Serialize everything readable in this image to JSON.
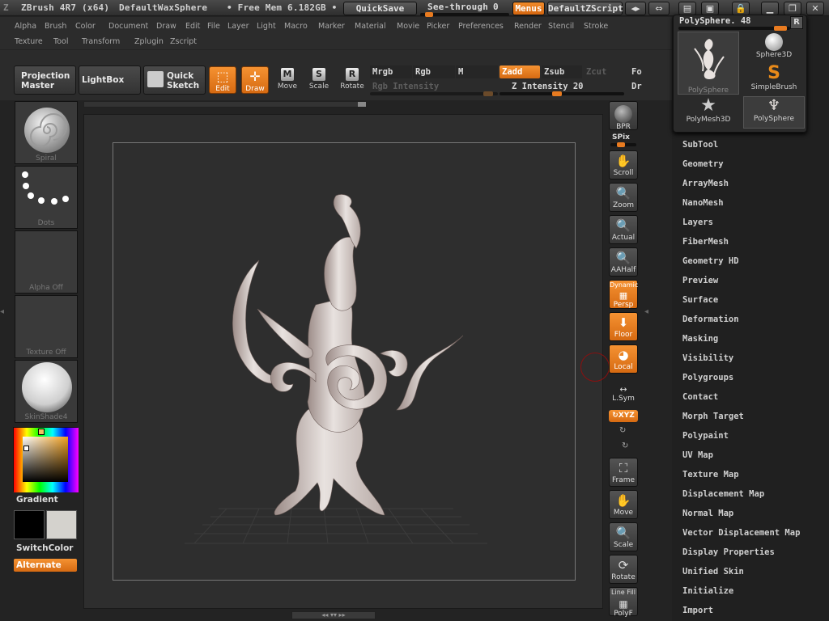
{
  "titlebar": {
    "app": "ZBrush 4R7 (x64)",
    "document": "DefaultWaxSphere",
    "mem": "• Free Mem 6.182GB •",
    "quicksave": "QuickSave",
    "seethrough": "See-through",
    "seethrough_value": "0",
    "seethrough_fraction": 0.05,
    "menus": "Menus",
    "zscript": "DefaultZScript",
    "icons": [
      "left-right-icon",
      "double-arrows-icon",
      "layout-icon",
      "swap-icon",
      "lock-icon",
      "minimize-icon",
      "restore-icon",
      "close-icon"
    ]
  },
  "menubar": {
    "row1": [
      "Alpha",
      "Brush",
      "Color",
      "Document",
      "Draw",
      "Edit",
      "File",
      "Layer",
      "Light",
      "Macro",
      "Marker",
      "Material",
      "Movie",
      "Picker",
      "Preferences",
      "Render",
      "Stencil",
      "Stroke"
    ],
    "row2": [
      "Texture",
      "Tool",
      "Transform",
      "Zplugin",
      "Zscript"
    ]
  },
  "toolbar": {
    "projection_master_1": "Projection",
    "projection_master_2": "Master",
    "lightbox": "LightBox",
    "quick_sketch_1": "Quick",
    "quick_sketch_2": "Sketch",
    "edit": "Edit",
    "draw": "Draw",
    "move": "Move",
    "scale": "Scale",
    "rotate": "Rotate",
    "move_key": "M",
    "scale_key": "S",
    "rotate_key": "R",
    "mrgb": "Mrgb",
    "rgb": "Rgb",
    "m": "M",
    "zadd": "Zadd",
    "zsub": "Zsub",
    "zcut": "Zcut",
    "focal": "Fo",
    "rgb_intensity": "Rgb Intensity",
    "z_intensity": "Z Intensity 20",
    "z_intensity_fraction": 0.2,
    "draw_size": "Dr"
  },
  "leftshelf": {
    "spiral": "Spiral",
    "dots": "Dots",
    "alpha_off": "Alpha Off",
    "texture_off": "Texture Off",
    "skinshade": "SkinShade4",
    "gradient": "Gradient",
    "switchcolor": "SwitchColor",
    "alternate": "Alternate",
    "main_color": "#000000",
    "secondary_color": "#d4d2cd"
  },
  "rightshelf": {
    "bpr": "BPR",
    "spix": "SPix",
    "scroll": "Scroll",
    "zoom": "Zoom",
    "actual": "Actual",
    "aahalf": "AAHalf",
    "dynamic": "Dynamic",
    "persp": "Persp",
    "floor": "Floor",
    "local": "Local",
    "lsym": "L.Sym",
    "xyz": "XYZ",
    "frame": "Frame",
    "move": "Move",
    "scale": "Scale",
    "rotate": "Rotate",
    "linefill": "Line Fill",
    "polyf": "PolyF"
  },
  "popup": {
    "title": "PolySphere. 48",
    "r_label": "R",
    "items": [
      "PolySphere",
      "Sphere3D",
      "SimpleBrush",
      "PolyMesh3D",
      "PolySphere"
    ]
  },
  "palette": {
    "items": [
      "SubTool",
      "Geometry",
      "ArrayMesh",
      "NanoMesh",
      "Layers",
      "FiberMesh",
      "Geometry HD",
      "Preview",
      "Surface",
      "Deformation",
      "Masking",
      "Visibility",
      "Polygroups",
      "Contact",
      "Morph Target",
      "Polypaint",
      "UV Map",
      "Texture Map",
      "Displacement Map",
      "Normal Map",
      "Vector Displacement Map",
      "Display Properties",
      "Unified Skin",
      "Initialize",
      "Import"
    ]
  },
  "colors": {
    "accent": "#e87b20",
    "background": "#232323"
  }
}
